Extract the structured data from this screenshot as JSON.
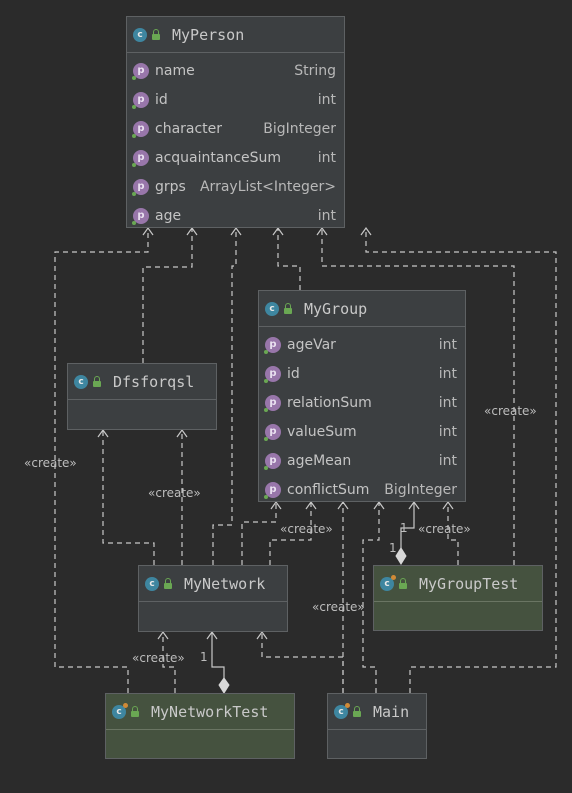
{
  "classes": {
    "myperson": {
      "name": "MyPerson",
      "fields": [
        {
          "name": "name",
          "type": "String"
        },
        {
          "name": "id",
          "type": "int"
        },
        {
          "name": "character",
          "type": "BigInteger"
        },
        {
          "name": "acquaintanceSum",
          "type": "int"
        },
        {
          "name": "grps",
          "type": "ArrayList<Integer>"
        },
        {
          "name": "age",
          "type": "int"
        }
      ]
    },
    "mygroup": {
      "name": "MyGroup",
      "fields": [
        {
          "name": "ageVar",
          "type": "int"
        },
        {
          "name": "id",
          "type": "int"
        },
        {
          "name": "relationSum",
          "type": "int"
        },
        {
          "name": "valueSum",
          "type": "int"
        },
        {
          "name": "ageMean",
          "type": "int"
        },
        {
          "name": "conflictSum",
          "type": "BigInteger"
        }
      ]
    },
    "dfsforqsl": {
      "name": "Dfsforqsl"
    },
    "mynetwork": {
      "name": "MyNetwork"
    },
    "mygrouptest": {
      "name": "MyGroupTest"
    },
    "mynetworktest": {
      "name": "MyNetworkTest"
    },
    "main": {
      "name": "Main"
    }
  },
  "icons": {
    "class_letter": "c",
    "field_letter": "p"
  },
  "labels": {
    "create_1": "«create»",
    "create_2": "«create»",
    "create_3": "«create»",
    "create_4": "«create»",
    "create_5": "«create»",
    "create_6": "«create»",
    "create_7": "«create»"
  },
  "multiplicities": {
    "group_one": "1",
    "group_one_b": "1",
    "network_one": "1"
  },
  "colors": {
    "background": "#2b2b2b",
    "class_box": "#3c3f41",
    "test_box": "#45523f",
    "class_icon": "#3e86a0",
    "field_icon": "#9876aa",
    "edge": "#c8c8c8"
  }
}
